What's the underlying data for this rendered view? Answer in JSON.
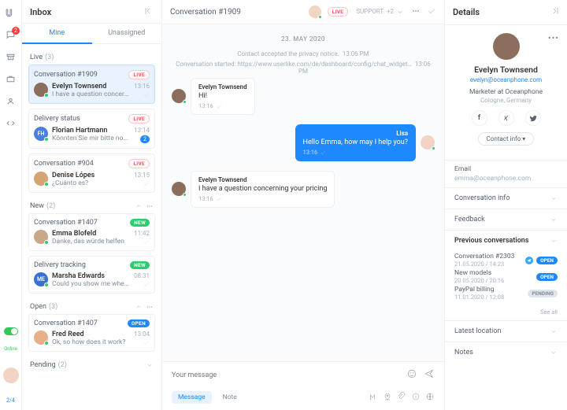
{
  "rail": {
    "badge": "2",
    "online": "Online",
    "fraction": "2/4"
  },
  "inbox": {
    "title": "Inbox",
    "tabs": [
      "Mine",
      "Unassigned"
    ],
    "sections": [
      {
        "name": "Live",
        "count": "(3)",
        "items": [
          {
            "title": "Conversation #1909",
            "badge": "LIVE",
            "badgeType": "live",
            "avatarBg": "#8b6f5c",
            "initials": "",
            "name": "Evelyn Townsend",
            "preview": "I have a question concerning y…",
            "time": "13:16",
            "mark": "check",
            "selected": true
          },
          {
            "title": "Delivery status",
            "badge": "LIVE",
            "badgeType": "live",
            "avatarBg": "#4a7fe0",
            "initials": "FH",
            "name": "Florian Hartmann",
            "preview": "Könnten Sie mir bitte noch d…",
            "time": "13:14",
            "mark": "num",
            "num": "2"
          },
          {
            "title": "Conversation #904",
            "badge": "LIVE",
            "badgeType": "live",
            "avatarBg": "#d4a573",
            "initials": "",
            "name": "Denise Lópes",
            "preview": "¿Cuánto es?",
            "time": "13:15",
            "mark": "check"
          }
        ]
      },
      {
        "name": "New",
        "count": "(2)",
        "controls": true,
        "items": [
          {
            "title": "Conversation #1407",
            "badge": "NEW",
            "badgeType": "new",
            "avatarBg": "#c9a888",
            "initials": "",
            "name": "Emma Blofeld",
            "preview": "Danke, das würde helfen",
            "time": "11:42",
            "mark": "check"
          },
          {
            "title": "Delivery tracking",
            "badge": "NEW",
            "badgeType": "new",
            "avatarBg": "#3a6fd8",
            "initials": "ME",
            "name": "Marsha Edwards",
            "preview": "Could you show me where I can t…",
            "time": "08:31",
            "mark": "check"
          }
        ]
      },
      {
        "name": "Open",
        "count": "(3)",
        "controls": true,
        "items": [
          {
            "title": "Conversation #1407",
            "badge": "OPEN",
            "badgeType": "open",
            "avatarBg": "#e8b088",
            "initials": "",
            "name": "Fred Reed",
            "preview": "Ok, so how does it work?",
            "time": "13:04",
            "mark": "check"
          }
        ]
      },
      {
        "name": "Pending",
        "count": "(2)",
        "collapsed": true
      }
    ]
  },
  "convo": {
    "title": "Conversation #1909",
    "live": "LIVE",
    "support": "SUPPORT",
    "supportExtra": "+2",
    "date": "23. MAY 2020",
    "sys": [
      {
        "text": "Contact accepted the privacy notice.",
        "time": "13:06 PM"
      },
      {
        "text": "Conversation started: https://www.userlike.com/de/dashboard/config/chat_widget…",
        "time": "13:06 PM"
      }
    ],
    "messages": [
      {
        "side": "in",
        "name": "Evelyn Townsend",
        "text": "Hi!",
        "time": "13:16"
      },
      {
        "side": "out",
        "name": "Lisa",
        "text": "Hello Emma, how may I help you?",
        "time": "13:16"
      },
      {
        "side": "in",
        "name": "Evelyn Townsend",
        "text": "I have a question concerning your pricing",
        "time": "13:16"
      }
    ],
    "composer": {
      "placeholder": "Your message",
      "tabs": [
        "Message",
        "Note"
      ]
    }
  },
  "details": {
    "title": "Details",
    "name": "Evelyn Townsend",
    "email": "evelyn@oceanphone.com",
    "role": "Marketer at Oceanphone",
    "location": "Cologne, Germany",
    "contactInfoBtn": "Contact info ▾",
    "emailLabel": "Email",
    "emailVal": "emma@oceanphone.com",
    "sections": {
      "convinfo": "Conversation info",
      "feedback": "Feedback",
      "prev": "Previous conversations",
      "loc": "Latest location",
      "notes": "Notes",
      "seeAll": "See all"
    },
    "prev": [
      {
        "title": "Conversation #2303",
        "time": "21.05.2020 / 14:23",
        "badge": "OPEN",
        "type": "open",
        "tg": true
      },
      {
        "title": "New models",
        "time": "20.05.2020 / 20:16",
        "badge": "OPEN",
        "type": "open"
      },
      {
        "title": "PayPal billing",
        "time": "11.01.2020 / 12:08",
        "badge": "PENDING",
        "type": "pending"
      }
    ]
  }
}
